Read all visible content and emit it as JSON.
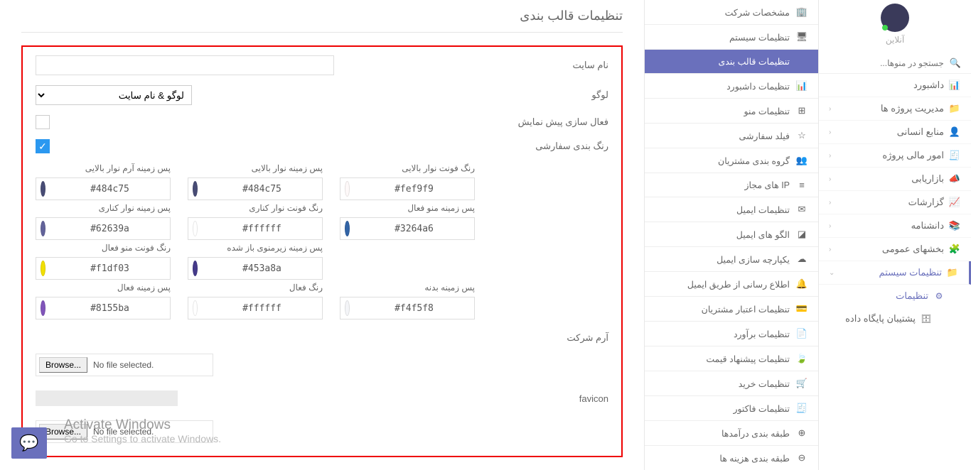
{
  "header": {
    "online": "آنلاین",
    "search_placeholder": "جستجو در منوها..."
  },
  "main_nav": [
    {
      "icon": "📊",
      "label": "داشبورد",
      "chev": false
    },
    {
      "icon": "📁",
      "label": "مدیریت پروژه ها",
      "chev": true
    },
    {
      "icon": "👤",
      "label": "منابع انسانی",
      "chev": true
    },
    {
      "icon": "🧾",
      "label": "امور مالی پروژه",
      "chev": true
    },
    {
      "icon": "📣",
      "label": "بازاریابی",
      "chev": true
    },
    {
      "icon": "📈",
      "label": "گزارشات",
      "chev": true
    },
    {
      "icon": "📚",
      "label": "دانشنامه",
      "chev": true
    },
    {
      "icon": "🧩",
      "label": "بخشهای عمومی",
      "chev": true
    },
    {
      "icon": "📁",
      "label": "تنظیمات سیستم",
      "chev": true,
      "active": true,
      "chev_down": true
    }
  ],
  "sub_nav": [
    {
      "icon": "⚙",
      "label": "تنظیمات",
      "active": true
    },
    {
      "icon": "🗄",
      "label": "پشتیبان پایگاه داده"
    }
  ],
  "settings_nav": [
    {
      "icon": "🏢",
      "label": "مشخصات شرکت"
    },
    {
      "icon": "🖥",
      "label": "تنظیمات سیستم"
    },
    {
      "icon": "</>",
      "label": "تنظیمات قالب بندی",
      "selected": true
    },
    {
      "icon": "📊",
      "label": "تنظیمات داشبورد"
    },
    {
      "icon": "⊞",
      "label": "تنظیمات منو"
    },
    {
      "icon": "☆",
      "label": "فیلد سفارشی"
    },
    {
      "icon": "👥",
      "label": "گروه بندی مشتریان"
    },
    {
      "icon": "≡",
      "label": "IP های مجاز"
    },
    {
      "icon": "✉",
      "label": "تنظیمات ایمیل"
    },
    {
      "icon": "◪",
      "label": "الگو های ایمیل"
    },
    {
      "icon": "☁",
      "label": "یکپارچه سازی ایمیل"
    },
    {
      "icon": "🔔",
      "label": "اطلاع رسانی از طریق ایمیل"
    },
    {
      "icon": "💳",
      "label": "تنظیمات اعتبار مشتریان"
    },
    {
      "icon": "📄",
      "label": "تنظیمات برآورد"
    },
    {
      "icon": "🍃",
      "label": "تنظیمات پیشنهاد قیمت"
    },
    {
      "icon": "🛒",
      "label": "تنظیمات خرید"
    },
    {
      "icon": "🧾",
      "label": "تنظیمات فاکتور"
    },
    {
      "icon": "⊕",
      "label": "طبقه بندی درآمدها"
    },
    {
      "icon": "⊖",
      "label": "طبقه بندی هزینه ها"
    }
  ],
  "page": {
    "title": "تنظیمات قالب بندی",
    "labels": {
      "site_name": "نام سایت",
      "logo": "لوگو",
      "preview": "فعال سازی پیش نمایش",
      "custom_color": "رنگ بندی سفارشی",
      "company_logo": "آرم شرکت",
      "favicon": "favicon"
    },
    "logo_select": "لوگو & نام سایت",
    "file": {
      "browse": "Browse...",
      "none": "No file selected."
    }
  },
  "colors": {
    "row1": [
      {
        "label": "پس زمینه آرم نوار بالایی",
        "value": "#484c75",
        "swatch": "#484c75"
      },
      {
        "label": "پس زمینه نوار بالایی",
        "value": "#484c75",
        "swatch": "#484c75"
      },
      {
        "label": "رنگ فونت نوار بالایی",
        "value": "#fef9f9",
        "swatch": "#fef9f9"
      }
    ],
    "row2": [
      {
        "label": "پس زمینه نوار کناری",
        "value": "#62639a",
        "swatch": "#62639a"
      },
      {
        "label": "رنگ فونت نوار کناری",
        "value": "#ffffff",
        "swatch": "#ffffff"
      },
      {
        "label": "پس زمینه منو فعال",
        "value": "#3264a6",
        "swatch": "#3264a6"
      }
    ],
    "row3": [
      {
        "label": "رنگ فونت منو فعال",
        "value": "#f1df03",
        "swatch": "#f1df03"
      },
      {
        "label": "پس زمینه زیرمنوی باز شده",
        "value": "#453a8a",
        "swatch": "#453a8a"
      },
      {
        "label": "",
        "value": "",
        "swatch": ""
      }
    ],
    "row4": [
      {
        "label": "پس زمینه فعال",
        "value": "#8155ba",
        "swatch": "#8155ba"
      },
      {
        "label": "رنگ فعال",
        "value": "#ffffff",
        "swatch": "#ffffff"
      },
      {
        "label": "پس زمینه بدنه",
        "value": "#f4f5f8",
        "swatch": "#f4f5f8"
      }
    ]
  },
  "watermark": {
    "l1": "Activate Windows",
    "l2": "Go to Settings to activate Windows."
  }
}
